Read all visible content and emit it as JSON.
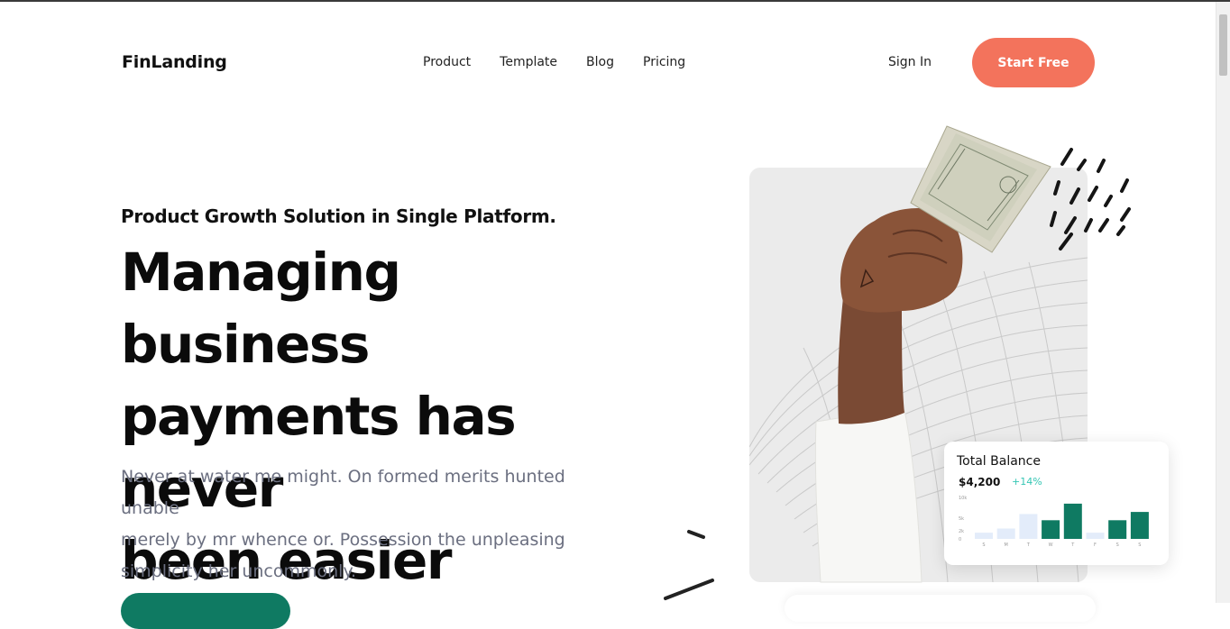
{
  "header": {
    "logo": "FinLanding",
    "nav": [
      "Product",
      "Template",
      "Blog",
      "Pricing"
    ],
    "sign_in": "Sign In",
    "start_free": "Start Free"
  },
  "hero": {
    "subheading": "Product Growth Solution in Single Platform.",
    "headline_lines": [
      "Managing business",
      "payments has never",
      "been easier"
    ],
    "description_lines": [
      "Never at water me might. On formed merits hunted unable",
      "merely by mr whence or. Possession the unpleasing",
      "simplicity her uncommonly."
    ]
  },
  "balance_card": {
    "title": "Total Balance",
    "amount": "$4,200",
    "change": "+14%"
  },
  "chart_data": {
    "type": "bar",
    "categories": [
      "S",
      "M",
      "T",
      "W",
      "T",
      "F",
      "S",
      "S"
    ],
    "y_ticks": [
      "10k",
      "5k",
      "2k",
      "0"
    ],
    "values": [
      1.5,
      2.5,
      6.0,
      4.5,
      8.5,
      1.5,
      4.5,
      6.5
    ],
    "highlighted": [
      false,
      false,
      false,
      true,
      true,
      false,
      true,
      true
    ],
    "colors": {
      "highlight": "#0f7a62",
      "muted": "#e3ecfa"
    }
  },
  "colors": {
    "accent": "#f3735c",
    "primary_green": "#0f7a62",
    "text_muted": "#6b6f80",
    "positive": "#35c6b4"
  }
}
